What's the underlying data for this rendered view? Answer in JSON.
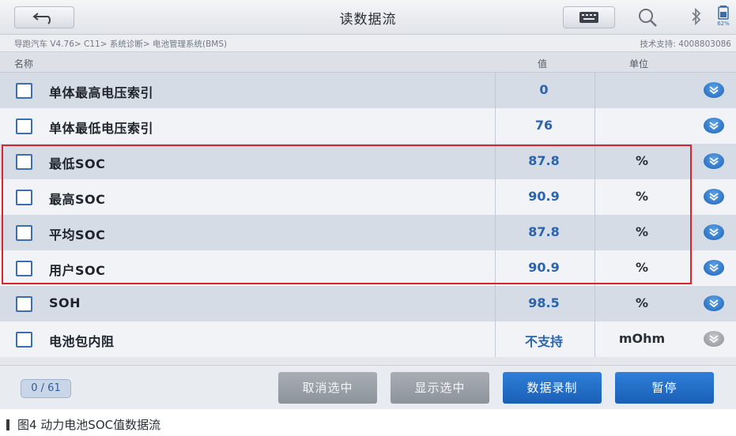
{
  "header": {
    "title": "读数据流",
    "battery_percent": "62%"
  },
  "breadcrumb": {
    "path": "导跑汽车 V4.76> C11> 系统诊断> 电池管理系统(BMS)",
    "support": "技术支持: 4008803086"
  },
  "table": {
    "columns": {
      "name": "名称",
      "value": "值",
      "unit": "单位"
    },
    "rows": [
      {
        "name": "单体最高电压索引",
        "value": "0",
        "unit": ""
      },
      {
        "name": "单体最低电压索引",
        "value": "76",
        "unit": ""
      },
      {
        "name": "最低SOC",
        "value": "87.8",
        "unit": "%"
      },
      {
        "name": "最高SOC",
        "value": "90.9",
        "unit": "%"
      },
      {
        "name": "平均SOC",
        "value": "87.8",
        "unit": "%"
      },
      {
        "name": "用户SOC",
        "value": "90.9",
        "unit": "%"
      },
      {
        "name": "SOH",
        "value": "98.5",
        "unit": "%"
      },
      {
        "name": "电池包内阻",
        "value": "不支持",
        "unit": "mOhm"
      }
    ]
  },
  "footer": {
    "page_count": "0 / 61",
    "buttons": {
      "deselect": "取消选中",
      "show_selected": "显示选中",
      "record": "数据录制",
      "pause": "暂停"
    }
  },
  "caption": "图4   动力电池SOC值数据流",
  "colors": {
    "accent_blue": "#2a64ae",
    "highlight_red": "#d8262c",
    "button_blue": "#1a5fb6"
  },
  "icons": [
    "back-arrow-icon",
    "keyboard-icon",
    "search-icon",
    "bluetooth-icon",
    "battery-icon",
    "chevron-down-icon"
  ]
}
